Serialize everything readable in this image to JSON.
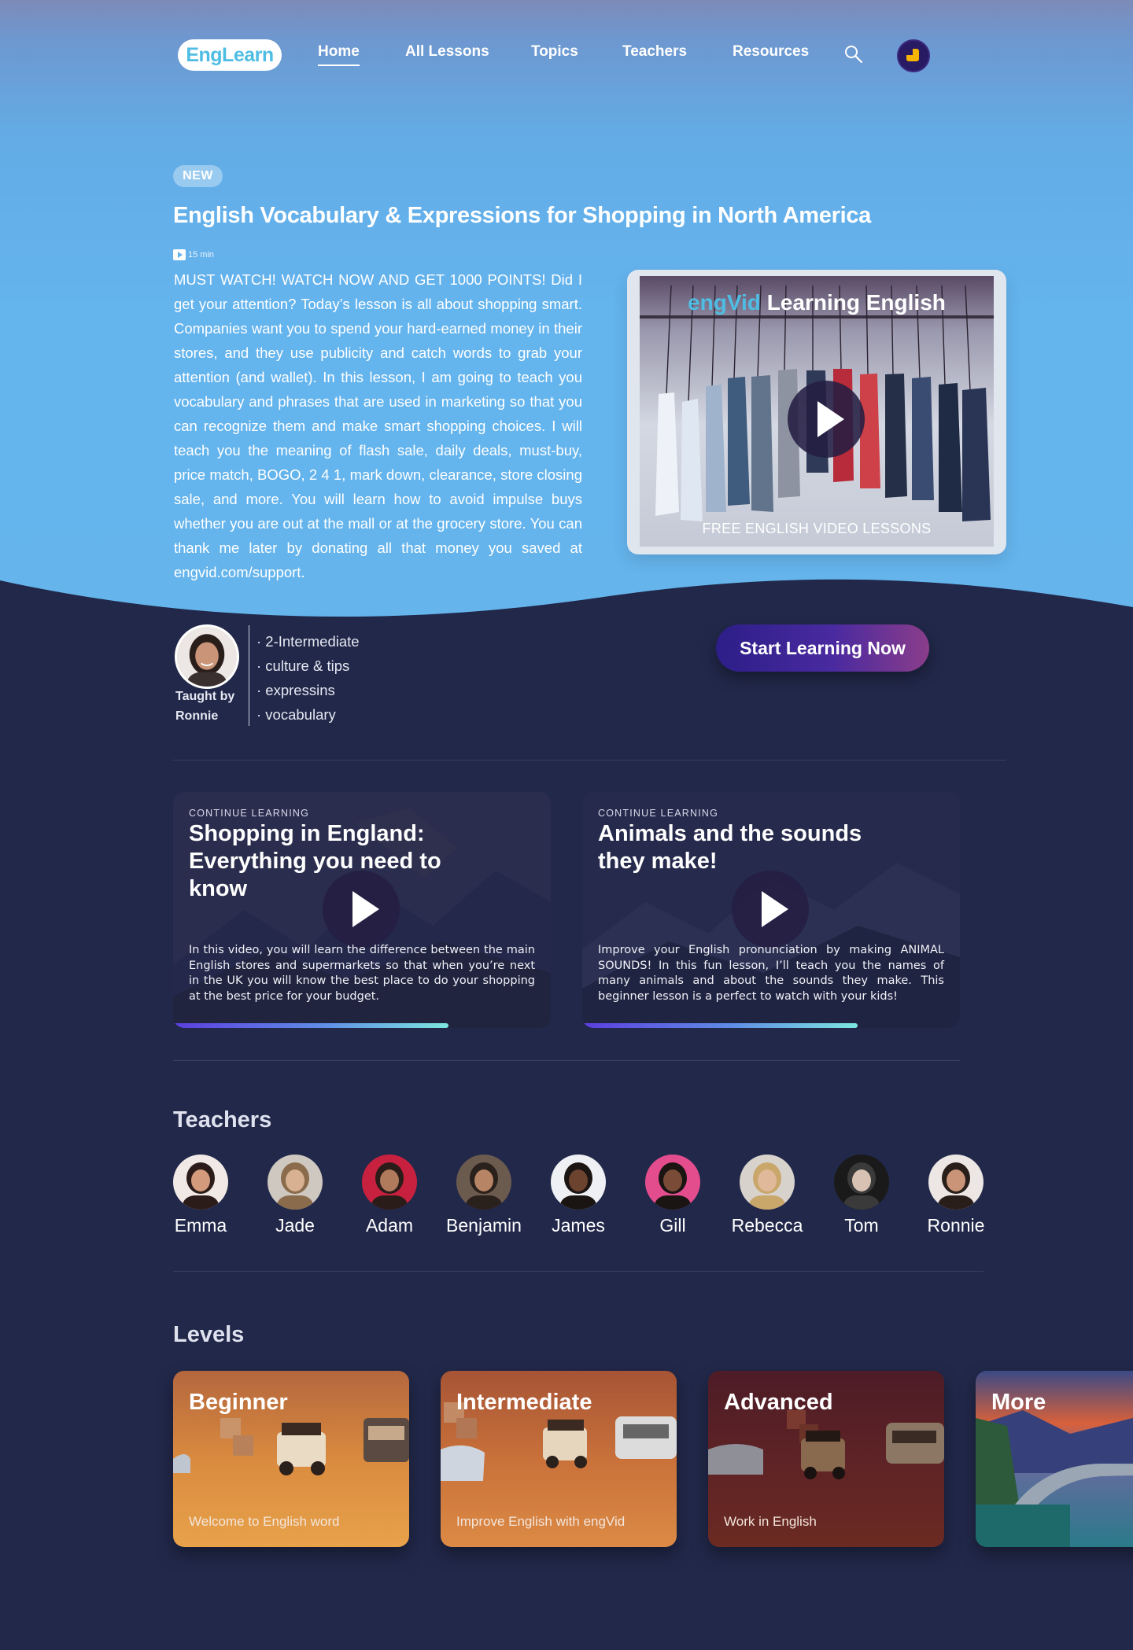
{
  "nav": {
    "logo": "EngLearn",
    "links": [
      "Home",
      "All Lessons",
      "Topics",
      "Teachers",
      "Resources"
    ]
  },
  "hero": {
    "badge": "NEW",
    "title": "English Vocabulary & Expressions for Shopping in North America",
    "duration": "15 min",
    "description": "MUST WATCH! WATCH NOW AND GET 1000 POINTS! Did I get your attention? Today’s lesson is all about shopping smart. Companies want you to spend your hard-earned money in their stores, and they use publicity and catch words to grab your attention (and wallet). In this lesson, I am going to teach you vocabulary and phrases that are used in marketing so that you can recognize them and make smart shopping choices. I will teach you the meaning of flash sale, daily deals, must-buy, price match, BOGO, 2 4 1, mark down, clearance, store closing sale, and more. You will learn how to avoid impulse buys whether you are out at the mall or at the grocery store. You can thank me later by donating all that money you saved at engvid.com/support.",
    "video_brand_a": "engVid",
    "video_brand_b": "Learning English",
    "video_caption": "FREE ENGLISH VIDEO LESSONS",
    "taught_by_label": "Taught by",
    "teacher": "Ronnie",
    "tags": [
      "· 2-Intermediate",
      "· culture & tips",
      "· expressins",
      "· vocabulary"
    ],
    "cta": "Start Learning Now"
  },
  "continue": [
    {
      "kicker": "CONTINUE LEARNING",
      "title": "Shopping in England: Everything you need to know",
      "description": "In this video, you will learn the difference between the main English stores and supermarkets so that when you’re next in the UK you will know the best place to do your shopping at the best price for your budget.",
      "progress": 0.73
    },
    {
      "kicker": "CONTINUE LEARNING",
      "title": "Animals and the sounds they make!",
      "description": "Improve your English pronunciation by making ANIMAL SOUNDS! In this fun lesson, I’ll teach you the names of many animals and about the sounds they make. This beginner lesson is a perfect to watch with your kids!",
      "progress": 0.73
    }
  ],
  "teachers": {
    "title": "Teachers",
    "list": [
      "Emma",
      "Jade",
      "Adam",
      "Benjamin",
      "James",
      "Gill",
      "Rebecca",
      "Tom",
      "Ronnie"
    ]
  },
  "levels": {
    "title": "Levels",
    "cards": [
      {
        "title": "Beginner",
        "subtitle": "Welcome to English word"
      },
      {
        "title": "Intermediate",
        "subtitle": "Improve English with engVid"
      },
      {
        "title": "Advanced",
        "subtitle": "Work in English"
      },
      {
        "title": "More",
        "subtitle": ""
      }
    ]
  },
  "colors": {
    "hero_top": "#7d8bb8",
    "hero_sky": "#64b4ee",
    "page_bg": "#212849",
    "accent_cyan": "#4fbde3",
    "cta_start": "#2c1e88",
    "cta_end": "#8a3d8a"
  }
}
